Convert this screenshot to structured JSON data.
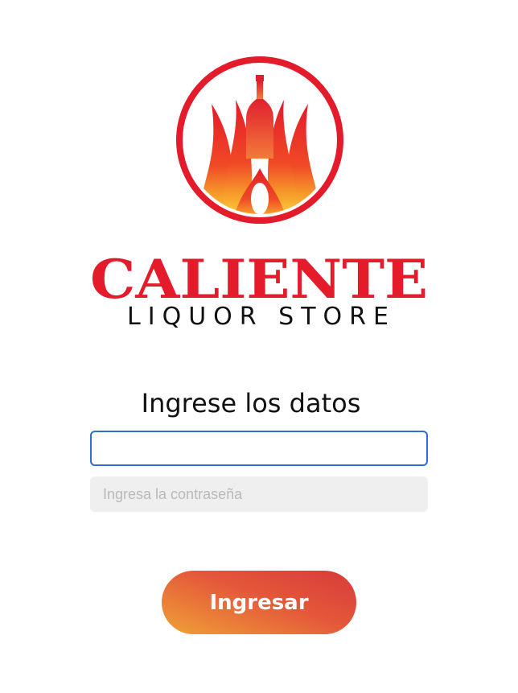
{
  "brand": {
    "name": "CALIENTE",
    "tagline": "LIQUOR STORE",
    "colors": {
      "red": "#e31b2b",
      "orange": "#f26a24",
      "yellow": "#fbd23a"
    }
  },
  "form": {
    "title": "Ingrese los datos",
    "username": {
      "value": "",
      "placeholder": ""
    },
    "password": {
      "value": "",
      "placeholder": "Ingresa la contraseña"
    },
    "submit_label": "Ingresar"
  }
}
